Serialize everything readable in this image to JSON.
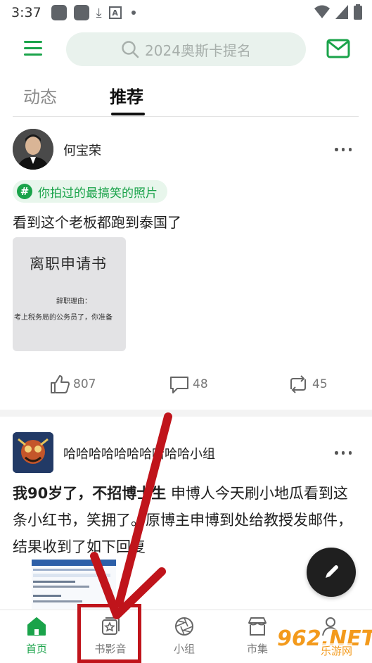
{
  "status_bar": {
    "time": "3:37"
  },
  "header": {
    "search_placeholder": "2024奥斯卡提名"
  },
  "tabs": [
    {
      "label": "动态",
      "active": false
    },
    {
      "label": "推荐",
      "active": true
    }
  ],
  "posts": [
    {
      "author": "何宝荣",
      "topic": "你拍过的最搞笑的照片",
      "text": "看到这个老板都跑到泰国了",
      "image_text": {
        "title": "离职申请书",
        "line1": "辞职理由：",
        "line2": "考上税务局的公务员了，你准备"
      },
      "likes": "807",
      "comments": "48",
      "reposts": "45"
    },
    {
      "author": "哈哈哈哈哈哈哈哈哈哈小组",
      "text_bold": "我90岁了，不招博士生",
      "text": " 申博人今天刷小地瓜看到这条小红书，笑拥了。原博主申博到处给教授发邮件，结果收到了如下回复"
    }
  ],
  "bottom_nav": [
    {
      "label": "首页",
      "active": true
    },
    {
      "label": "书影音",
      "active": false
    },
    {
      "label": "小组",
      "active": false
    },
    {
      "label": "市集",
      "active": false
    }
  ],
  "watermark": {
    "main": "962.NET",
    "sub": "乐游网"
  },
  "colors": {
    "accent": "#1aa34a",
    "annotation": "#c0141b"
  }
}
